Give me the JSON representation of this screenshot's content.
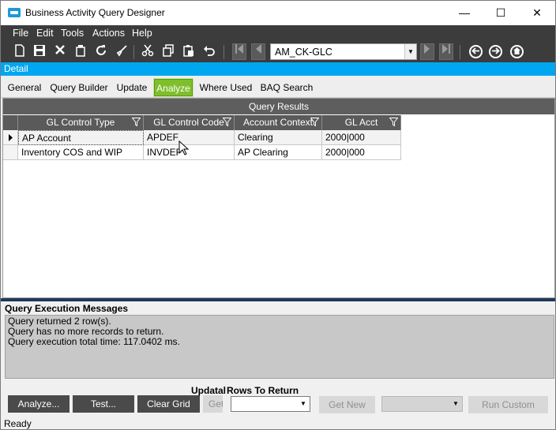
{
  "window": {
    "title": "Business Activity Query Designer",
    "minimize": "—",
    "maximize": "☐",
    "close": "✕"
  },
  "menu": {
    "items": [
      "File",
      "Edit",
      "Tools",
      "Actions",
      "Help"
    ]
  },
  "toolbar": {
    "key_value": "AM_CK-GLC",
    "icons": [
      "new-icon",
      "save-icon",
      "delete-icon",
      "clear-icon",
      "refresh-icon",
      "clean-icon",
      "cut-icon",
      "copy-icon",
      "paste-icon",
      "undo-icon",
      "first-icon",
      "prev-icon",
      "next-icon",
      "last-icon",
      "back-icon",
      "forward-icon",
      "home-icon"
    ]
  },
  "detail": {
    "label": "Detail"
  },
  "tabs": [
    "General",
    "Query Builder",
    "Update",
    "Analyze",
    "Where Used",
    "BAQ Search"
  ],
  "active_tab": "Analyze",
  "results": {
    "title": "Query Results",
    "columns": [
      "GL Control Type",
      "GL Control Code",
      "Account Context",
      "GL Acct"
    ],
    "rows": [
      [
        "AP Account",
        "APDEF",
        "Clearing",
        "2000|000"
      ],
      [
        "Inventory COS and WIP",
        "INVDEF",
        "AP Clearing",
        "2000|000"
      ]
    ]
  },
  "messages": {
    "title": "Query Execution Messages",
    "lines": [
      "Query returned 2 row(s).",
      "Query has no more records to return.",
      "Query execution total time: 117.0402 ms."
    ]
  },
  "bottom": {
    "analyze_label": "Analyze...",
    "test_label": "Test...",
    "clear_grid_label": "Clear Grid",
    "updatable_label": "Updatal",
    "get_label": "Get",
    "rows_to_return_label": "Rows To Return",
    "get_new_label": "Get New",
    "run_custom_label": "Run Custom"
  },
  "status": {
    "text": "Ready"
  },
  "colors": {
    "accent": "#00a6f0",
    "active_tab": "#7fbe2c",
    "dark_bar": "#3c3c3c"
  }
}
